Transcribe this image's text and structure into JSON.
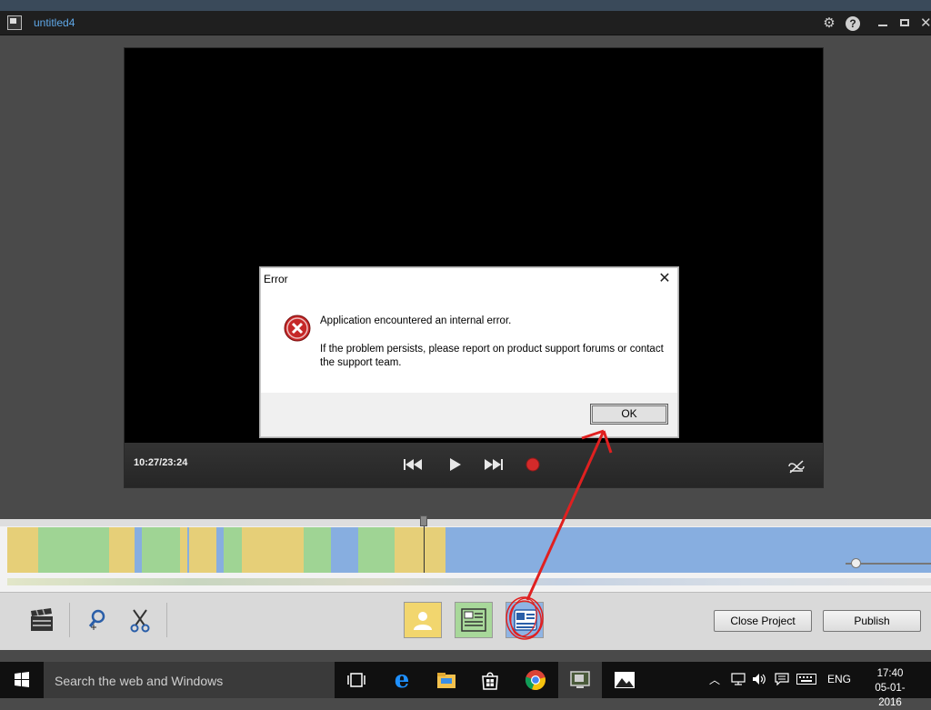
{
  "window": {
    "title": "untitled4"
  },
  "titlebar_icons": [
    "gear-icon",
    "help-icon",
    "minimize-icon",
    "maximize-icon",
    "close-icon"
  ],
  "help_glyph": "?",
  "preview": {
    "timecode": "10:27/23:24"
  },
  "dialog": {
    "title": "Error",
    "message": "Application encountered an internal error.",
    "detail": "If the problem persists, please report on product support forums or contact the support team.",
    "ok_label": "OK"
  },
  "toolbar": {
    "close_project_label": "Close Project",
    "publish_label": "Publish"
  },
  "taskbar": {
    "search_placeholder": "Search the web and Windows",
    "language": "ENG",
    "time": "17:40",
    "date": "05-01-2016"
  },
  "colors": {
    "accent": "#5fa8e8",
    "segment_yellow": "#e6cf78",
    "segment_green": "#9fd494",
    "segment_blue": "#87aee0",
    "annotation_red": "#e02020"
  }
}
